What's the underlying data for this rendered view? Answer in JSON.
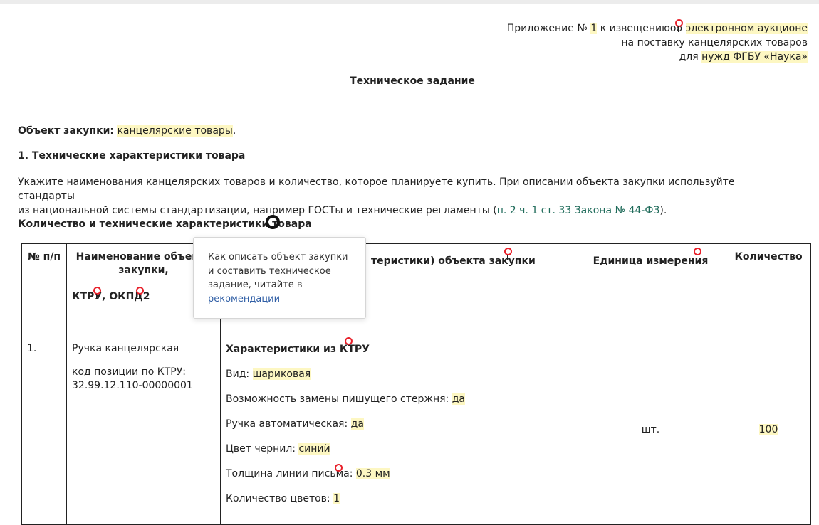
{
  "header": {
    "line1_prefix": "Приложение № ",
    "line1_num": "1",
    "line1_mid": " к извещению",
    "line1_about": "об ",
    "line1_hl": "электронном аукционе",
    "line2": "на поставку канцелярских товаров",
    "line3_prefix": "для ",
    "line3_hl": "нужд ФГБУ «Наука»"
  },
  "title": "Техническое задание",
  "subject": {
    "label": "Объект закупки:",
    "value": "канцелярские товары",
    "tail": "."
  },
  "section1": "1. Технические характеристики товара",
  "paragraph": {
    "text1": "Укажите наименования канцелярских товаров и количество, которое планируете купить. При описании объекта закупки используйте стандарты",
    "text2": "из национальной системы стандартизации, например ГОСТы и технические регламенты (",
    "link": "п. 2 ч. 1 ст. 33 Закона № 44-ФЗ",
    "text3": ")."
  },
  "qty_heading": "Количество и технические характеристики товара",
  "table": {
    "headers": {
      "num": "№ п/п",
      "name_top": "Наименование объекта закупки,",
      "name_bottom": "КТРУ, ОКПД2",
      "chars": "Характеристики (потребительские свойства и технические характеристики) объекта закупки",
      "chars_visible": "теристики) объекта закупки",
      "unit": "Единица измерения",
      "qty": "Количество"
    },
    "row": {
      "num": "1.",
      "name": "Ручка канцелярская",
      "code_label": "код позиции по КТРУ:",
      "code": "32.99.12.110-00000001",
      "chars_title": "Характеристики из КТРУ",
      "chars": [
        {
          "label": "Вид: ",
          "value": "шариковая"
        },
        {
          "label": "Возможность замены пишущего стержня: ",
          "value": "да"
        },
        {
          "label": "Ручка автоматическая: ",
          "value": "да"
        },
        {
          "label": "Цвет чернил: ",
          "value": "синий"
        },
        {
          "label": "Толщина линии письма: ",
          "value": "0.3 мм"
        },
        {
          "label": "Количество цветов: ",
          "value": "1"
        }
      ],
      "unit": "шт.",
      "qty": "100"
    }
  },
  "tooltip": {
    "text": "Как описать объект закупки и составить техническое задание, читайте в",
    "link": "рекомендации"
  },
  "colors": {
    "highlight": "#fdf7c2",
    "pin": "#e8202a",
    "link": "#2f5ea5",
    "legal_link": "#1f6b5a"
  }
}
